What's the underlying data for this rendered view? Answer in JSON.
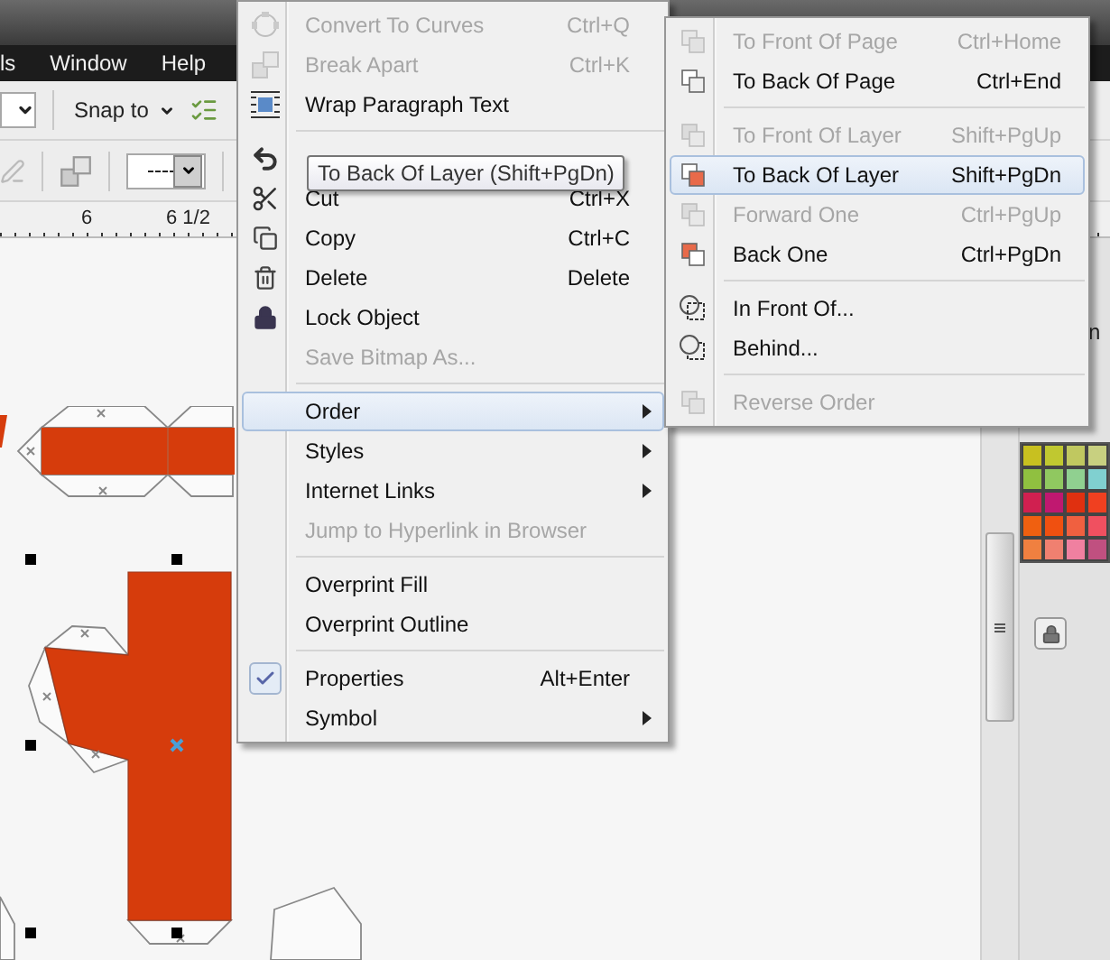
{
  "menubar": {
    "items": [
      {
        "label": "ls"
      },
      {
        "label": "Window"
      },
      {
        "label": "Help"
      }
    ]
  },
  "toolbar": {
    "snap_label": "Snap to"
  },
  "ruler": {
    "labels": [
      "6",
      "6 1/2"
    ]
  },
  "context_menu": {
    "groups": [
      [
        {
          "label": "Convert To Curves",
          "shortcut": "Ctrl+Q",
          "disabled": true,
          "selected": false,
          "submenu": false,
          "checked": false
        },
        {
          "label": "Break  Apart",
          "shortcut": "Ctrl+K",
          "disabled": true,
          "selected": false,
          "submenu": false,
          "checked": false
        },
        {
          "label": "Wrap Paragraph Text",
          "disabled": false,
          "selected": false,
          "submenu": false,
          "checked": false
        }
      ],
      [
        {
          "disabled": false,
          "selected": false,
          "submenu": false,
          "checked": false
        },
        {
          "label": "Cut",
          "shortcut": "Ctrl+X",
          "disabled": false,
          "selected": false,
          "submenu": false,
          "checked": false
        },
        {
          "label": "Copy",
          "shortcut": "Ctrl+C",
          "disabled": false,
          "selected": false,
          "submenu": false,
          "checked": false
        },
        {
          "label": "Delete",
          "shortcut": "Delete",
          "disabled": false,
          "selected": false,
          "submenu": false,
          "checked": false
        },
        {
          "label": "Lock Object",
          "disabled": false,
          "selected": false,
          "submenu": false,
          "checked": false
        },
        {
          "label": "Save Bitmap As...",
          "disabled": true,
          "selected": false,
          "submenu": false,
          "checked": false
        }
      ],
      [
        {
          "label": "Order",
          "disabled": false,
          "selected": true,
          "submenu": true,
          "checked": false
        },
        {
          "label": "Styles",
          "disabled": false,
          "selected": false,
          "submenu": true,
          "checked": false
        },
        {
          "label": "Internet Links",
          "disabled": false,
          "selected": false,
          "submenu": true,
          "checked": false
        },
        {
          "label": "Jump to Hyperlink in Browser",
          "disabled": true,
          "selected": false,
          "submenu": false,
          "checked": false
        }
      ],
      [
        {
          "label": "Overprint Fill",
          "disabled": false,
          "selected": false,
          "submenu": false,
          "checked": false
        },
        {
          "label": "Overprint Outline",
          "disabled": false,
          "selected": false,
          "submenu": false,
          "checked": false
        }
      ],
      [
        {
          "label": "Properties",
          "shortcut": "Alt+Enter",
          "disabled": false,
          "selected": false,
          "submenu": false,
          "checked": true
        },
        {
          "label": "Symbol",
          "disabled": false,
          "selected": false,
          "submenu": true,
          "checked": false
        }
      ]
    ]
  },
  "submenu": {
    "groups": [
      [
        {
          "label": "To Front Of Page",
          "shortcut": "Ctrl+Home",
          "disabled": true,
          "selected": false
        },
        {
          "label": "To Back Of Page",
          "shortcut": "Ctrl+End",
          "disabled": false,
          "selected": false
        }
      ],
      [
        {
          "label": "To Front Of Layer",
          "shortcut": "Shift+PgUp",
          "disabled": true,
          "selected": false
        },
        {
          "label": "To Back Of Layer",
          "shortcut": "Shift+PgDn",
          "disabled": false,
          "selected": true
        },
        {
          "label": "Forward One",
          "shortcut": "Ctrl+PgUp",
          "disabled": true,
          "selected": false
        },
        {
          "label": "Back One",
          "shortcut": "Ctrl+PgDn",
          "disabled": false,
          "selected": false
        }
      ],
      [
        {
          "label": "In Front Of...",
          "disabled": false,
          "selected": false
        },
        {
          "label": "Behind...",
          "disabled": false,
          "selected": false
        }
      ],
      [
        {
          "label": "Reverse Order",
          "disabled": true,
          "selected": false
        }
      ]
    ]
  },
  "tooltip": {
    "text": "To Back Of Layer (Shift+PgDn)"
  },
  "docker": {
    "header_fragment": "n"
  },
  "palette": {
    "swatches": [
      {
        "color": "#c8c020"
      },
      {
        "color": "#c0c830"
      },
      {
        "color": "#c0c860"
      },
      {
        "color": "#c8d080"
      },
      {
        "color": "#90c040"
      },
      {
        "color": "#90c860"
      },
      {
        "color": "#90d090"
      },
      {
        "color": "#80d0d0"
      },
      {
        "color": "#d02050"
      },
      {
        "color": "#c01870"
      },
      {
        "color": "#e03010"
      },
      {
        "color": "#f04020"
      },
      {
        "color": "#f06010"
      },
      {
        "color": "#f05010"
      },
      {
        "color": "#f06040"
      },
      {
        "color": "#f05060"
      },
      {
        "color": "#f08040"
      },
      {
        "color": "#f08070"
      },
      {
        "color": "#f080a0"
      },
      {
        "color": "#c05080"
      }
    ]
  }
}
